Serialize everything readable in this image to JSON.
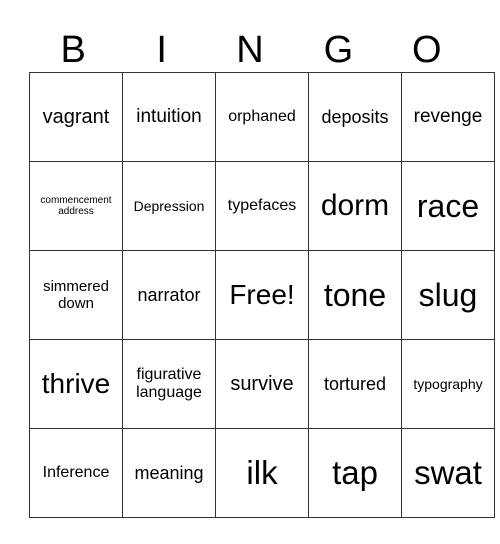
{
  "header": [
    "B",
    "I",
    "N",
    "G",
    "O"
  ],
  "grid": [
    [
      "vagrant",
      "intuition",
      "orphaned",
      "deposits",
      "revenge"
    ],
    [
      "commencement address",
      "Depression",
      "typefaces",
      "dorm",
      "race"
    ],
    [
      "simmered down",
      "narrator",
      "Free!",
      "tone",
      "slug"
    ],
    [
      "thrive",
      "figurative language",
      "survive",
      "tortured",
      "typography"
    ],
    [
      "Inference",
      "meaning",
      "ilk",
      "tap",
      "swat"
    ]
  ]
}
